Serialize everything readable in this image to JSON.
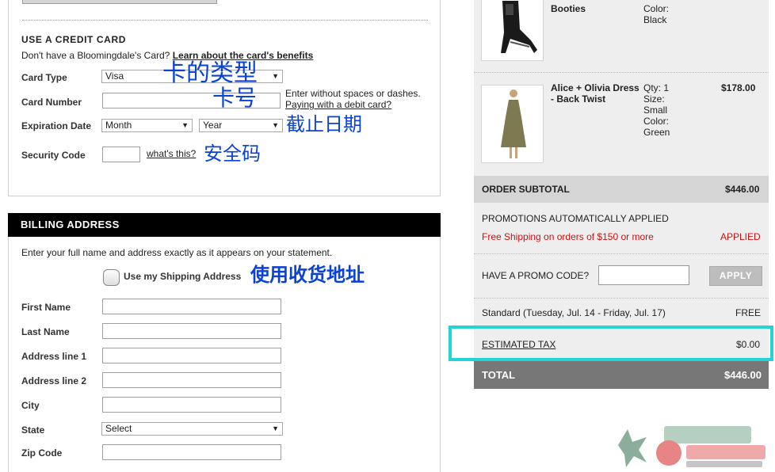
{
  "credit_card": {
    "heading": "USE A CREDIT CARD",
    "no_card_text": "Don't have a Bloomingdale's Card?",
    "learn_link": "Learn about the card's benefits",
    "card_type_label": "Card Type",
    "card_type_value": "Visa",
    "card_number_label": "Card Number",
    "card_number_hint": "Enter without spaces or dashes.",
    "debit_link": "Paying with a debit card?",
    "expiration_label": "Expiration Date",
    "month_value": "Month",
    "year_value": "Year",
    "security_label": "Security Code",
    "whats_this_link": "what's this?"
  },
  "annotations": {
    "card_type": "卡的类型",
    "card_number": "卡号",
    "expiration": "截止日期",
    "security": "安全码",
    "use_shipping": "使用收货地址"
  },
  "billing": {
    "heading": "BILLING ADDRESS",
    "instructions": "Enter your full name and address exactly as it appears on your statement.",
    "use_shipping_label": "Use my Shipping Address",
    "first_name_label": "First Name",
    "last_name_label": "Last Name",
    "address1_label": "Address line 1",
    "address2_label": "Address line 2",
    "city_label": "City",
    "state_label": "State",
    "state_value": "Select",
    "zip_label": "Zip Code"
  },
  "order": {
    "item1": {
      "name_partial": "Booties",
      "color_label": "Color:",
      "color_value": "Black"
    },
    "item2": {
      "name_line1": "Alice + Olivia Dress",
      "name_line2": "- Back Twist",
      "qty": "Qty: 1",
      "size_label": "Size:",
      "size_value": "Small",
      "color_label": "Color:",
      "color_value": "Green",
      "price": "$178.00"
    },
    "subtotal_label": "ORDER SUBTOTAL",
    "subtotal_value": "$446.00",
    "promotions_label": "PROMOTIONS AUTOMATICALLY APPLIED",
    "promo_text": "Free Shipping on orders of $150 or more",
    "promo_status": "APPLIED",
    "promo_code_label": "HAVE A PROMO CODE?",
    "apply_label": "APPLY",
    "shipping_label": "Standard (Tuesday, Jul. 14 - Friday, Jul. 17)",
    "shipping_value": "FREE",
    "tax_label": "ESTIMATED TAX",
    "tax_value": "$0.00",
    "total_label": "TOTAL",
    "total_value": "$446.00"
  },
  "colors": {
    "annotation_blue": "#0a42d6",
    "highlight_cyan": "#22d3d8",
    "promo_red": "#d01010"
  }
}
